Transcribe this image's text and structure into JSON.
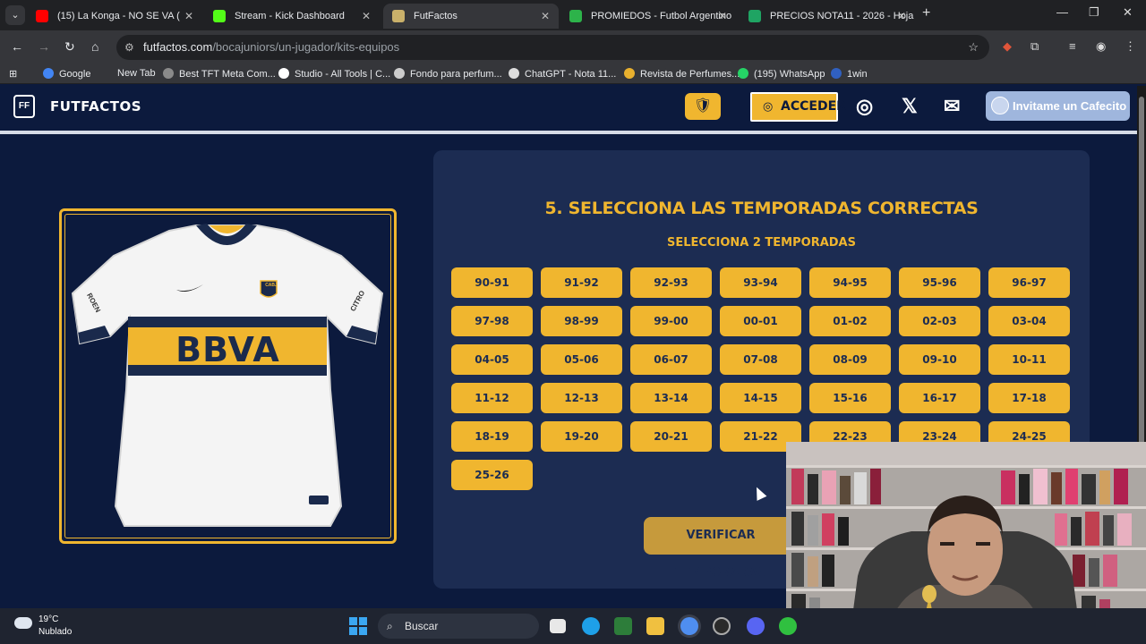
{
  "browser": {
    "tabs": [
      {
        "title": "(15) La Konga - NO SE VA (",
        "color": "#ff0000"
      },
      {
        "title": "Stream - Kick Dashboard",
        "color": "#53fc18"
      },
      {
        "title": "FutFactos",
        "color": "#c9b06a",
        "active": true
      },
      {
        "title": "PROMIEDOS - Futbol Argentino",
        "color": "#2db34a"
      },
      {
        "title": "PRECIOS NOTA11 - 2026 - Hoja",
        "color": "#1fa463"
      }
    ],
    "url_domain": "futfactos.com",
    "url_path": "/bocajuniors/un-jugador/kits-equipos",
    "bookmarks": [
      {
        "label": "Google",
        "color": "#4285f4"
      },
      {
        "label": "New Tab",
        "color": "#35363a"
      },
      {
        "label": "Best TFT Meta Com...",
        "color": "#8a8a8a"
      },
      {
        "label": "Studio - All Tools | C...",
        "color": "#ffffff"
      },
      {
        "label": "Fondo para perfum...",
        "color": "#cccccc"
      },
      {
        "label": "ChatGPT - Nota 11...",
        "color": "#dddddd"
      },
      {
        "label": "Revista de Perfumes...",
        "color": "#e8b02e"
      },
      {
        "label": "(195) WhatsApp",
        "color": "#25d366"
      },
      {
        "label": "1win",
        "color": "#3060c0"
      }
    ]
  },
  "site": {
    "logo_text": "FUTFACTOS",
    "logo_mark": "FF",
    "login_label": "ACCEDER",
    "cafecito_label": "Invitame un Cafecito",
    "accent_color": "#f0b62f"
  },
  "jersey": {
    "sponsor": "BBVA",
    "brand_left": "ROEN",
    "brand_right": "CITRO",
    "crest": "CABJ"
  },
  "step": {
    "title": "5. SELECCIONA LAS TEMPORADAS CORRECTAS",
    "subtitle": "SELECCIONA 2 TEMPORADAS",
    "seasons": [
      "90-91",
      "91-92",
      "92-93",
      "93-94",
      "94-95",
      "95-96",
      "96-97",
      "97-98",
      "98-99",
      "99-00",
      "00-01",
      "01-02",
      "02-03",
      "03-04",
      "04-05",
      "05-06",
      "06-07",
      "07-08",
      "08-09",
      "09-10",
      "10-11",
      "11-12",
      "12-13",
      "13-14",
      "14-15",
      "15-16",
      "16-17",
      "17-18",
      "18-19",
      "19-20",
      "20-21",
      "21-22",
      "22-23",
      "23-24",
      "24-25",
      "25-26"
    ],
    "verify_label": "VERIFICAR TEMPORADAS"
  },
  "taskbar": {
    "temperature": "19°C",
    "weather": "Nublado",
    "search_placeholder": "Buscar"
  }
}
